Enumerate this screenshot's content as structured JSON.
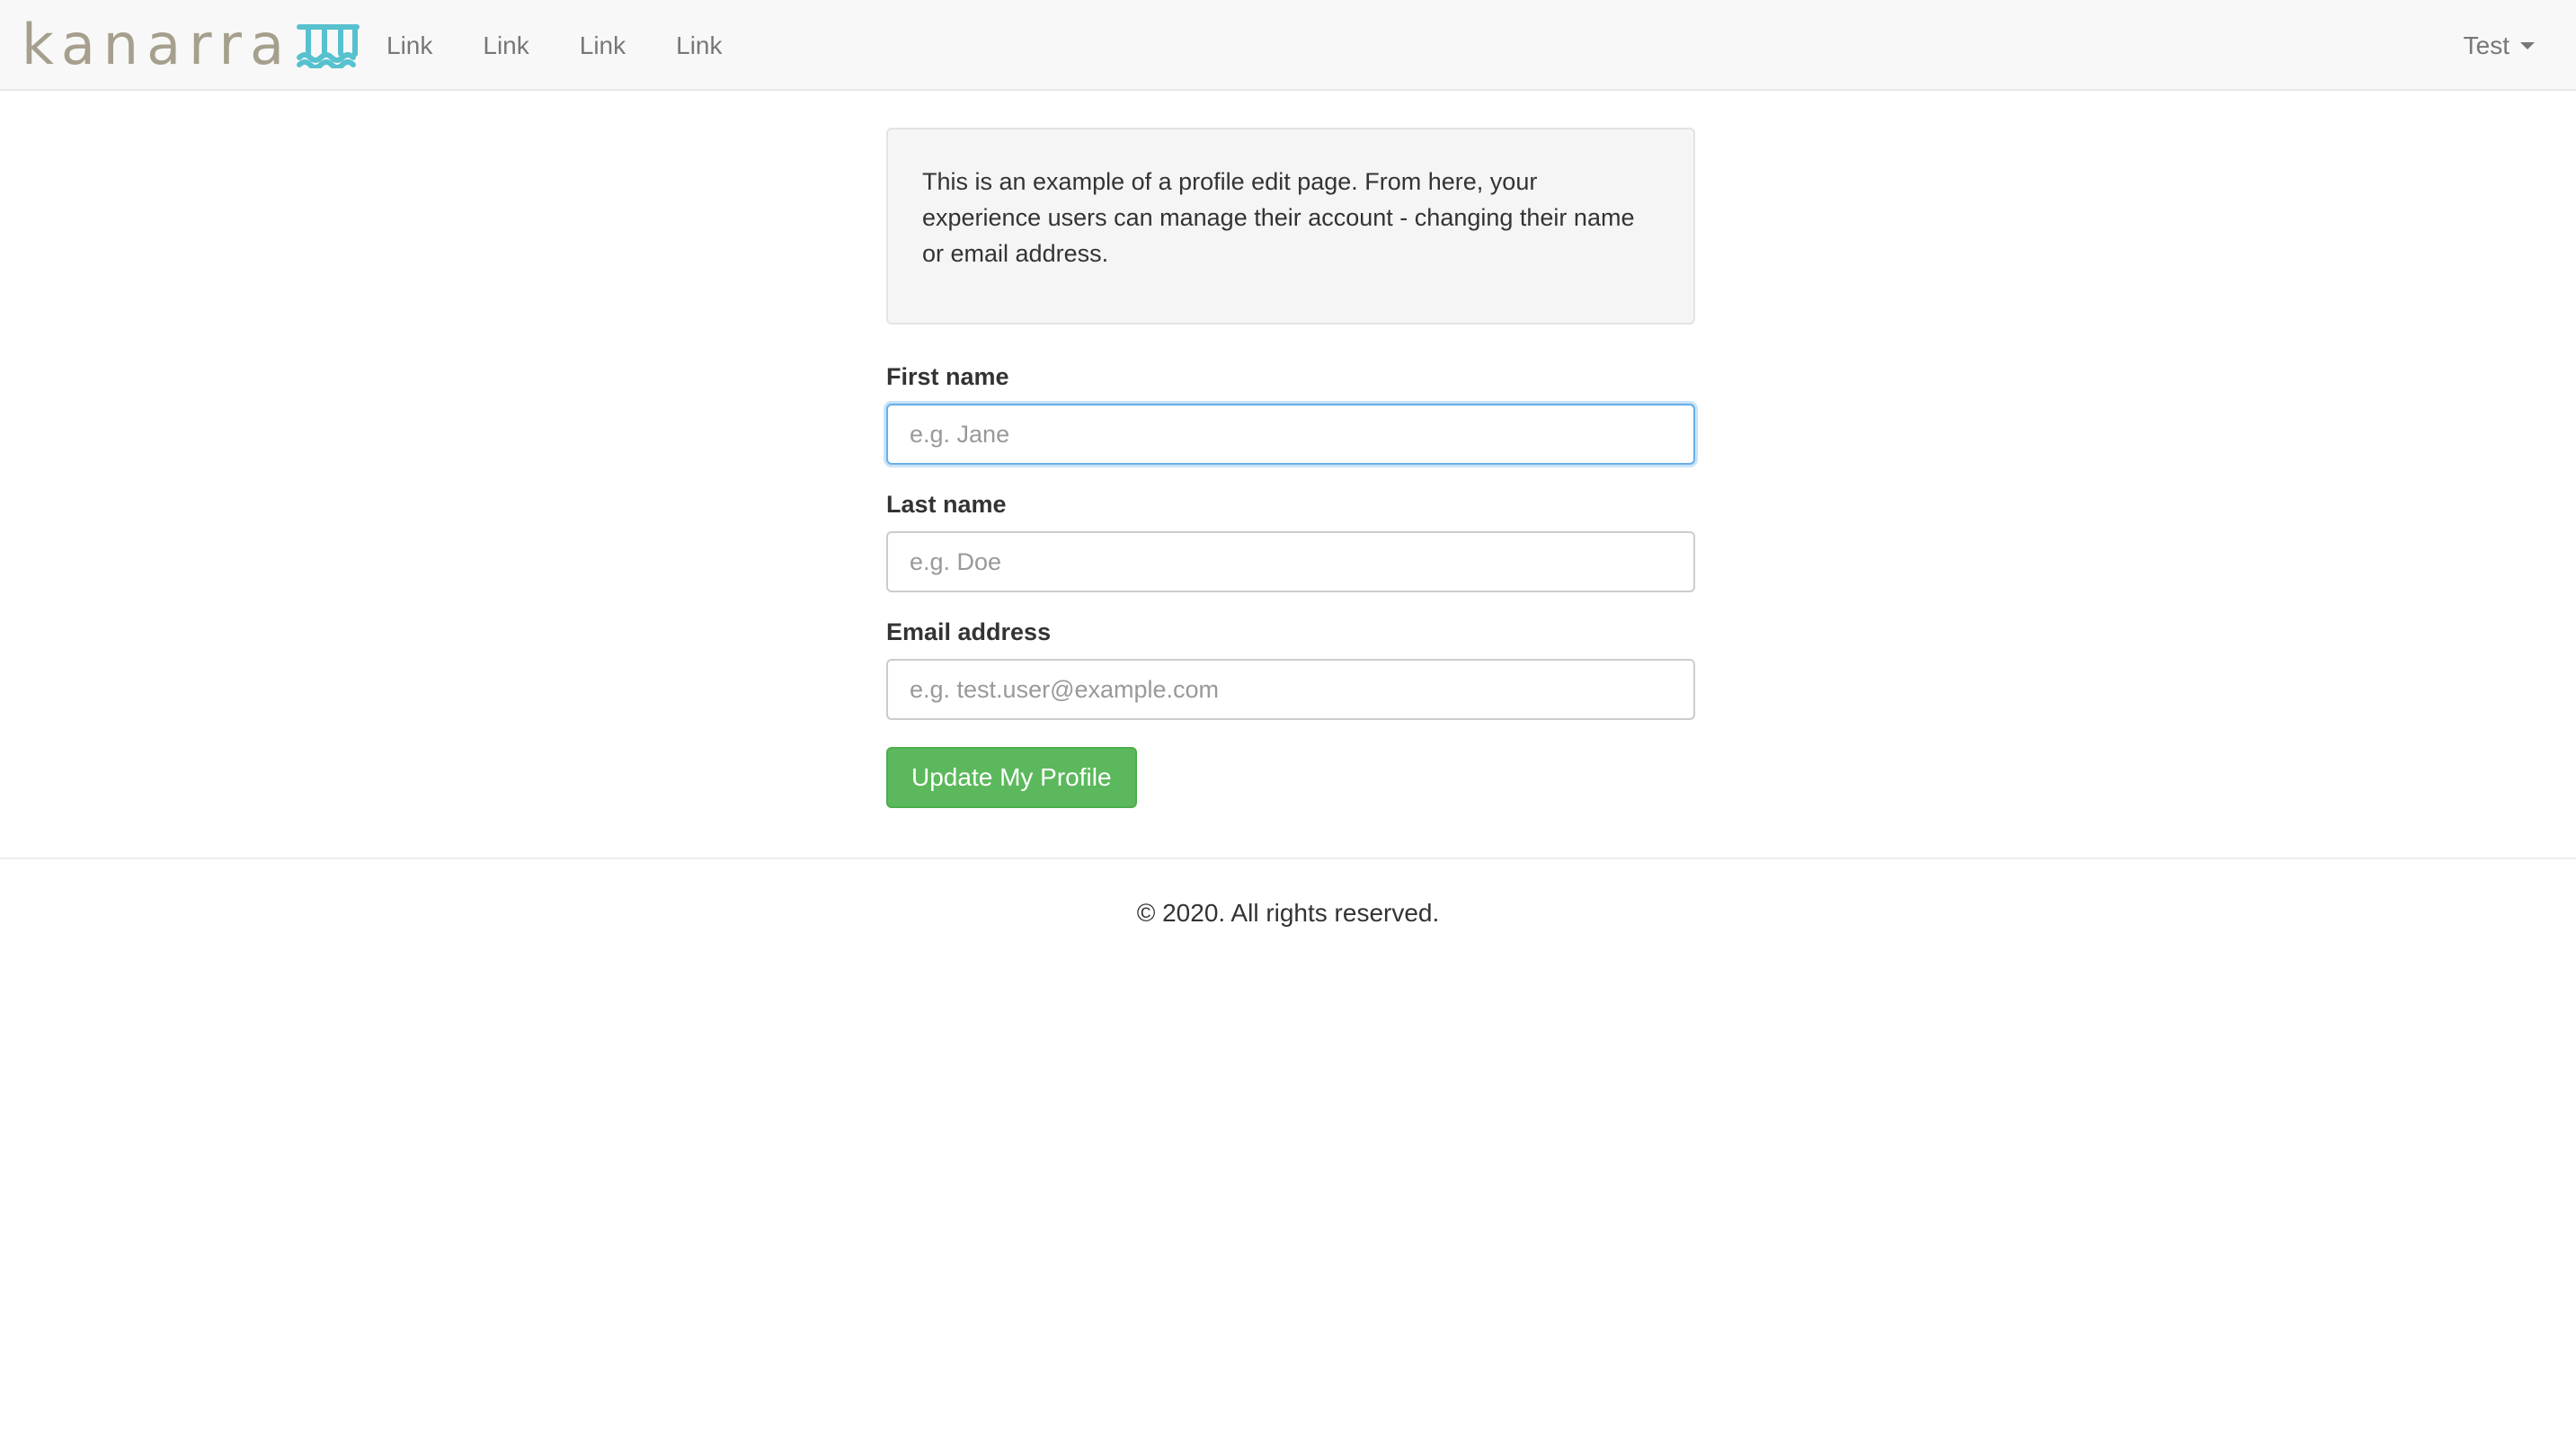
{
  "navbar": {
    "brand": "kanarra",
    "brand_icon": "kanarra-wave-mark-icon",
    "links": [
      "Link",
      "Link",
      "Link",
      "Link"
    ],
    "user_menu_label": "Test",
    "colors": {
      "background": "#f8f8f8",
      "brand_text": "#a69f8d",
      "brand_mark": "#57c1cf"
    }
  },
  "intro": {
    "text": "This is an example of a profile edit page. From here, your experience users can manage their account - changing their name or email address."
  },
  "form": {
    "first_name": {
      "label": "First name",
      "value": "",
      "placeholder": "e.g. Jane",
      "focused": true
    },
    "last_name": {
      "label": "Last name",
      "value": "",
      "placeholder": "e.g. Doe"
    },
    "email": {
      "label": "Email address",
      "value": "",
      "placeholder": "e.g. test.user@example.com"
    },
    "submit_label": "Update My Profile",
    "submit_color": "#5cb85c"
  },
  "footer": {
    "copyright": "© 2020. All rights reserved."
  }
}
